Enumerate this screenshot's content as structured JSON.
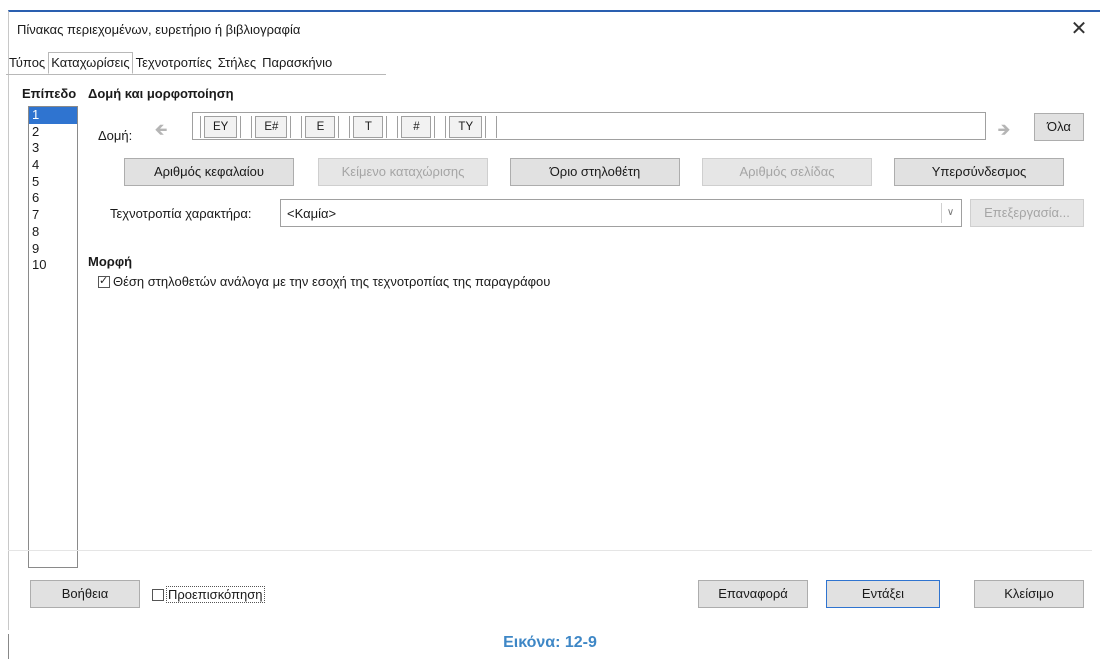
{
  "window": {
    "title": "Πίνακας περιεχομένων, ευρετήριο ή βιβλιογραφία",
    "close_glyph": "✕"
  },
  "tabs": [
    {
      "label": "Τύπος"
    },
    {
      "label": "Καταχωρίσεις",
      "active": true
    },
    {
      "label": "Τεχνοτροπίες"
    },
    {
      "label": "Στήλες"
    },
    {
      "label": "Παρασκήνιο"
    }
  ],
  "level": {
    "header": "Επίπεδο",
    "items": [
      "1",
      "2",
      "3",
      "4",
      "5",
      "6",
      "7",
      "8",
      "9",
      "10"
    ],
    "selected": "1"
  },
  "structure": {
    "section_title": "Δομή και μορφοποίηση",
    "label": "Δομή:",
    "tokens": [
      "ΕΥ",
      "Ε#",
      "Ε",
      "Τ",
      "#",
      "ΤΥ"
    ],
    "all_button": "Όλα",
    "left_arrow_icon": "arrow-left-icon",
    "right_arrow_icon": "arrow-right-icon"
  },
  "insert_buttons": {
    "chapter_number": "Αριθμός κεφαλαίου",
    "entry_text": "Κείμενο καταχώρισης",
    "tab_stop": "Όριο στηλοθέτη",
    "page_number": "Αριθμός σελίδας",
    "hyperlink": "Υπερσύνδεσμος"
  },
  "character_style": {
    "label": "Τεχνοτροπία χαρακτήρα:",
    "value": "<Καμία>",
    "edit_button": "Επεξεργασία..."
  },
  "format": {
    "title": "Μορφή",
    "checkbox_label": "Θέση στηλοθετών ανάλογα με την εσοχή της τεχνοτροπίας της παραγράφου",
    "checked": true
  },
  "footer": {
    "help": "Βοήθεια",
    "preview": "Προεπισκόπηση",
    "reset": "Επαναφορά",
    "insert": "Εντάξει",
    "close": "Κλείσιμο"
  },
  "caption": "Εικόνα: 12-9",
  "colors": {
    "accent": "#2f74d0",
    "caption": "#3e87c6"
  }
}
